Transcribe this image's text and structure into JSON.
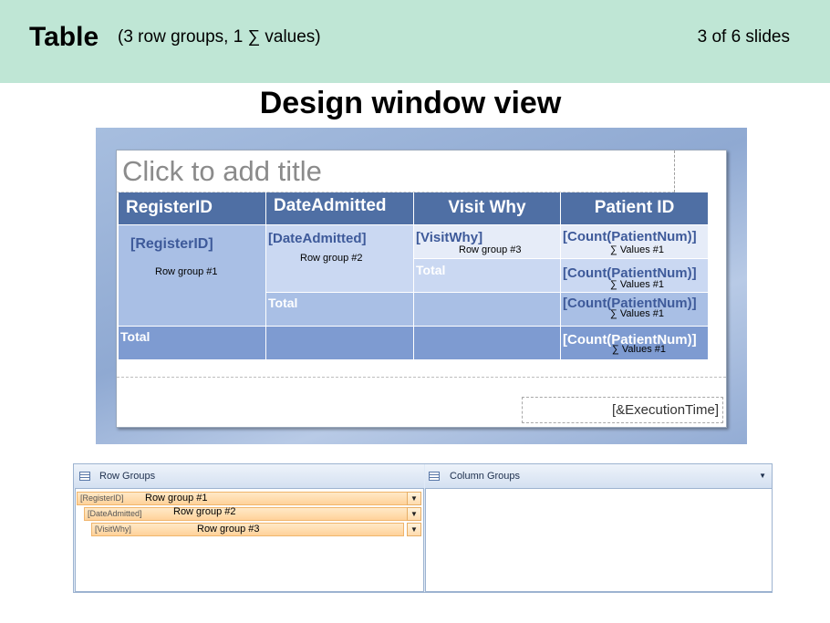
{
  "banner": {
    "title": "Table",
    "subtitle": "(3 row groups, 1 ∑ values)",
    "counter": "3 of 6 slides"
  },
  "heading": "Design window view",
  "design_window": {
    "title_placeholder": "Click to add title",
    "headers": [
      "RegisterID",
      "DateAdmitted",
      "Visit Why",
      "Patient ID"
    ],
    "fields": {
      "register_id": "[RegisterID]",
      "date_admitted": "[DateAdmitted]",
      "visit_why": "[VisitWhy]",
      "count": "[Count(PatientNum)]"
    },
    "labels": {
      "row_group_1": "Row group #1",
      "row_group_2": "Row group #2",
      "row_group_3": "Row group #3",
      "values": "∑ Values #1",
      "total": "Total"
    },
    "execution_time": "[&ExecutionTime]"
  },
  "groups_pane": {
    "row_groups_title": "Row Groups",
    "column_groups_title": "Column Groups",
    "row_groups": [
      {
        "field": "[RegisterID]",
        "caption": "Row group #1"
      },
      {
        "field": "[DateAdmitted]",
        "caption": "Row group #2"
      },
      {
        "field": "[VisitWhy]",
        "caption": "Row group #3"
      }
    ],
    "dropdown_glyph": "▼"
  }
}
